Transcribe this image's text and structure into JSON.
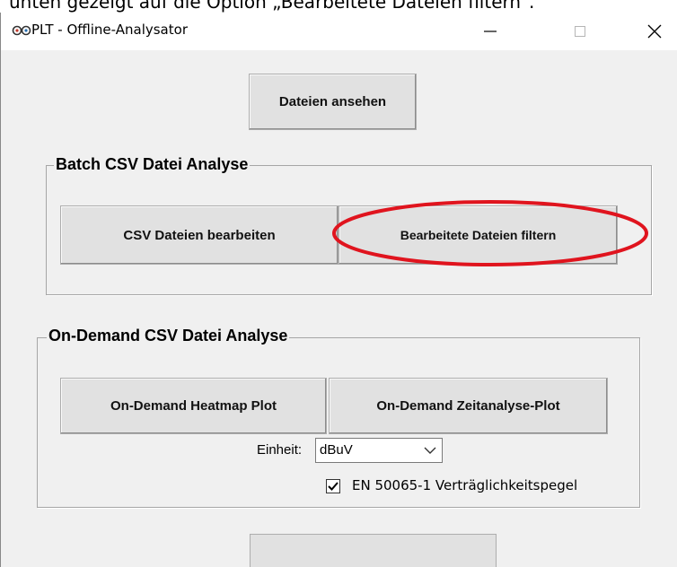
{
  "caption": "unten gezeigt auf die Option „Bearbeitete Dateien filtern“.",
  "window": {
    "title": "PLT - Offline-Analysator",
    "icon": "infinity-logo-icon",
    "controls": {
      "minimize_icon": "minimize-icon",
      "maximize_icon": "maximize-icon",
      "close_icon": "close-icon"
    }
  },
  "buttons": {
    "view_files": "Dateien ansehen",
    "edit_csv": "CSV Dateien bearbeiten",
    "filter_edited": "Bearbeitete Dateien filtern",
    "heatmap_plot": "On-Demand Heatmap Plot",
    "time_plot": "On-Demand Zeitanalyse-Plot",
    "bottom": ""
  },
  "groups": {
    "batch_title": "Batch CSV Datei Analyse",
    "ondemand_title": "On-Demand CSV Datei Analyse"
  },
  "unit": {
    "label": "Einheit:",
    "value": "dBuV"
  },
  "checkbox": {
    "label": "EN 50065-1 Verträglichkeitspegel",
    "checked": true
  },
  "annotation": {
    "color": "#e0141e"
  }
}
